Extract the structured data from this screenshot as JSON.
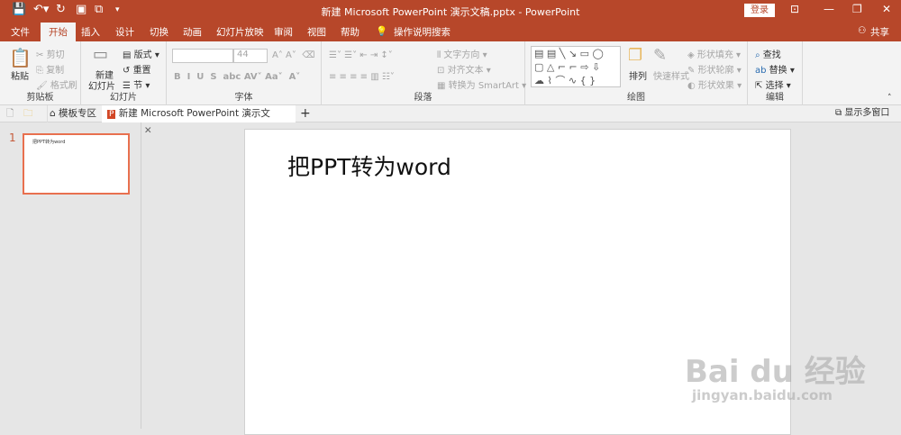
{
  "titlebar": {
    "title": "新建 Microsoft PowerPoint 演示文稿.pptx  -  PowerPoint",
    "login": "登录"
  },
  "menu": {
    "tabs": [
      "文件",
      "开始",
      "插入",
      "设计",
      "切换",
      "动画",
      "幻灯片放映",
      "审阅",
      "视图",
      "帮助"
    ],
    "tell_me": "操作说明搜索",
    "share": "共享"
  },
  "ribbon": {
    "clipboard": {
      "label": "剪贴板",
      "paste": "粘贴",
      "cut": "剪切",
      "copy": "复制",
      "format_painter": "格式刷"
    },
    "slides": {
      "label": "幻灯片",
      "new_slide_1": "新建",
      "new_slide_2": "幻灯片",
      "layout": "版式",
      "reset": "重置",
      "section": "节"
    },
    "font": {
      "label": "字体",
      "font_name": "",
      "font_size": "44"
    },
    "paragraph": {
      "label": "段落",
      "text_direction": "文字方向",
      "align_text": "对齐文本",
      "smartart": "转换为 SmartArt"
    },
    "drawing": {
      "label": "绘图",
      "arrange": "排列",
      "quick_styles": "快速样式",
      "shape_fill": "形状填充",
      "shape_outline": "形状轮廓",
      "shape_effects": "形状效果"
    },
    "editing": {
      "label": "编辑",
      "find": "查找",
      "replace": "替换",
      "select": "选择"
    }
  },
  "doctabs": {
    "templates": "模板专区",
    "doc": "新建 Microsoft PowerPoint 演示文稿.pptx",
    "multi_window": "显示多窗口"
  },
  "slides": [
    {
      "number": "1",
      "title": "把PPT转为word"
    }
  ],
  "watermark": {
    "brand": "Bai du 经验",
    "url": "jingyan.baidu.com"
  }
}
